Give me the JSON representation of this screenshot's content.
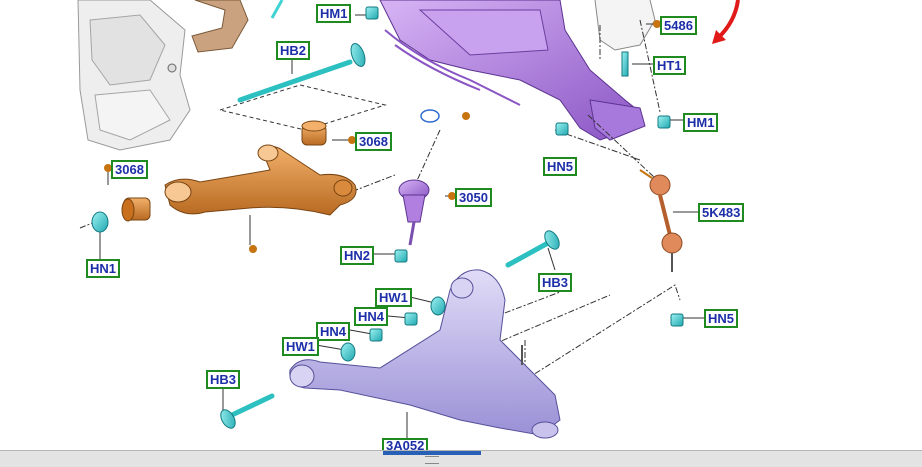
{
  "callouts": {
    "hm1_top": "HM1",
    "p5486": "5486",
    "hb2": "HB2",
    "ht1": "HT1",
    "hm1_right": "HM1",
    "p3068_center": "3068",
    "hn5_top": "HN5",
    "p3068_left": "3068",
    "p3050": "3050",
    "p5k483": "5K483",
    "hn1": "HN1",
    "hn2": "HN2",
    "hb3_right": "HB3",
    "hw1_top": "HW1",
    "hn4_top": "HN4",
    "hn5_bottom": "HN5",
    "hn4_bottom": "HN4",
    "hw1_bottom": "HW1",
    "hb3_left": "HB3",
    "p3a052": "3A052"
  },
  "colors": {
    "callout_border": "#1f8a1f",
    "callout_text": "#1c2fa8",
    "marker": "#c7730f",
    "upper_arm": "#d78a3e",
    "lower_arm": "#b7afe6",
    "steering_gear": "#b07fe0",
    "fastener": "#3fd3d3",
    "tie_rod_end": "#e0895a",
    "arrow": "#e01919"
  }
}
